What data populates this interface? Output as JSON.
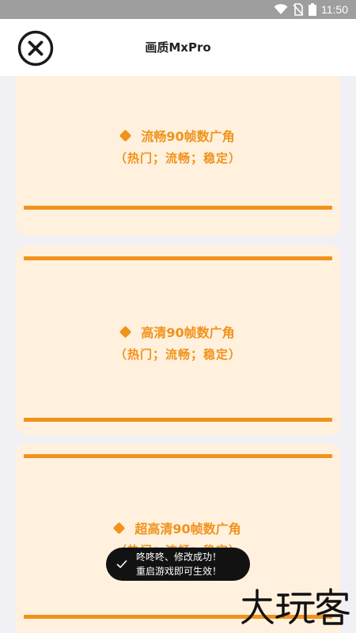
{
  "status_bar": {
    "time": "11:50",
    "icons": [
      "wifi-icon",
      "no-sim-icon",
      "battery-icon"
    ]
  },
  "header": {
    "title": "画质MxPro",
    "close_icon": "close-circle-icon"
  },
  "cards": [
    {
      "name": "流畅90帧数广角",
      "tags": "（热门；流畅；稳定）"
    },
    {
      "name": "高清90帧数广角",
      "tags": "（热门；流畅；稳定）"
    },
    {
      "name": "超高清90帧数广角",
      "tags": "（热门；流畅；稳定）"
    }
  ],
  "toast": {
    "icon": "check-icon",
    "message": "咚咚咚、修改成功！\n重启游戏即可生效！"
  },
  "watermark": {
    "text": "大玩客"
  },
  "colors": {
    "accent": "#f1921a",
    "card_bg": "#fff1de",
    "page_bg": "#f1f0f5",
    "status_bar": "#9e9e9e",
    "toast_bg": "#121212"
  }
}
